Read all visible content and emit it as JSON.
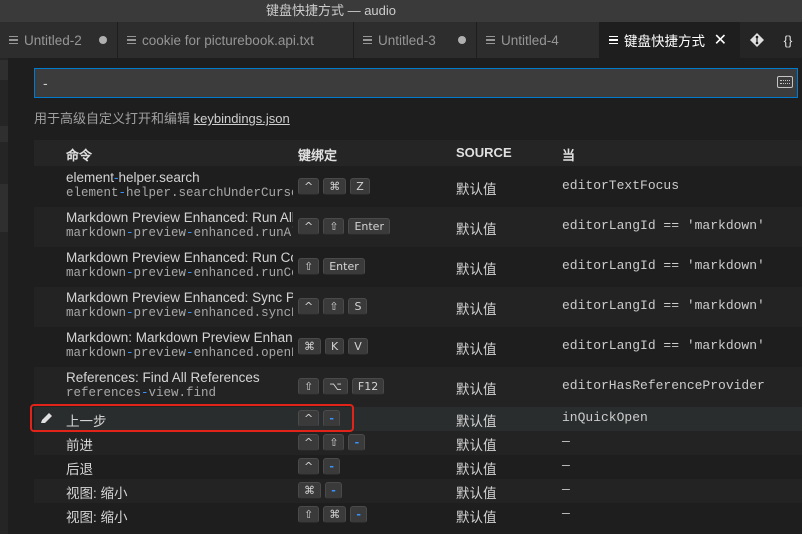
{
  "window": {
    "title": "键盘快捷方式 — audio"
  },
  "tabs": [
    {
      "label": "Untitled-2",
      "dirty": true,
      "active": false
    },
    {
      "label": "cookie for picturebook.api.txt",
      "dirty": false,
      "active": false
    },
    {
      "label": "Untitled-3",
      "dirty": true,
      "active": false
    },
    {
      "label": "Untitled-4",
      "dirty": false,
      "active": false
    },
    {
      "label": "键盘快捷方式",
      "dirty": false,
      "active": true,
      "close": "✕"
    }
  ],
  "tab_actions": {
    "git_icon": "git-compare-icon",
    "json_label": "{}"
  },
  "search": {
    "value": "-",
    "placeholder": ""
  },
  "hint": {
    "text": "用于高级自定义打开和编辑 ",
    "link": "keybindings.json"
  },
  "columns": {
    "command": "命令",
    "keybinding": "键绑定",
    "source": "SOURCE",
    "when": "当"
  },
  "rows": [
    {
      "title": "element-helper.search",
      "id": "element-helper.searchUnderCursor",
      "keys": [
        "^",
        "⌘",
        "Z"
      ],
      "source": "默认值",
      "when": "editorTextFocus"
    },
    {
      "title": "Markdown Preview Enhanced: Run All Code Chunks",
      "id": "markdown-preview-enhanced.runAllCodeChunks",
      "keys": [
        "^",
        "⇧",
        "Enter"
      ],
      "source": "默认值",
      "when": "editorLangId == 'markdown'"
    },
    {
      "title": "Markdown Preview Enhanced: Run Code Chunk",
      "id": "markdown-preview-enhanced.runCodeChunk",
      "keys": [
        "⇧",
        "Enter"
      ],
      "source": "默认值",
      "when": "editorLangId == 'markdown'"
    },
    {
      "title": "Markdown Preview Enhanced: Sync Preview",
      "id": "markdown-preview-enhanced.syncPreview",
      "keys": [
        "^",
        "⇧",
        "S"
      ],
      "source": "默认值",
      "when": "editorLangId == 'markdown'"
    },
    {
      "title": "Markdown: Markdown Preview Enhanced: Open Preview",
      "id": "markdown-preview-enhanced.openPreview",
      "keys": [
        "⌘",
        "K",
        "V"
      ],
      "source": "默认值",
      "when": "editorLangId == 'markdown'"
    },
    {
      "title": "References: Find All References",
      "id": "references-view.find",
      "keys": [
        "⇧",
        "⌥",
        "F12"
      ],
      "source": "默认值",
      "when": "editorHasReferenceProvider"
    },
    {
      "title": "上一步",
      "keys": [
        "^",
        "-"
      ],
      "source": "默认值",
      "when": "inQuickOpen",
      "selected": true
    },
    {
      "title": "前进",
      "keys": [
        "^",
        "⇧",
        "-"
      ],
      "source": "默认值",
      "when": "—"
    },
    {
      "title": "后退",
      "keys": [
        "^",
        "-"
      ],
      "source": "默认值",
      "when": "—"
    },
    {
      "title": "视图: 缩小",
      "keys": [
        "⌘",
        "-"
      ],
      "source": "默认值",
      "when": "—"
    },
    {
      "title": "视图: 缩小",
      "keys": [
        "⇧",
        "⌘",
        "-"
      ],
      "source": "默认值",
      "when": "—"
    }
  ],
  "colors": {
    "accent": "#007acc",
    "highlight": "#e2231a",
    "hyphen": "#3794ff"
  }
}
